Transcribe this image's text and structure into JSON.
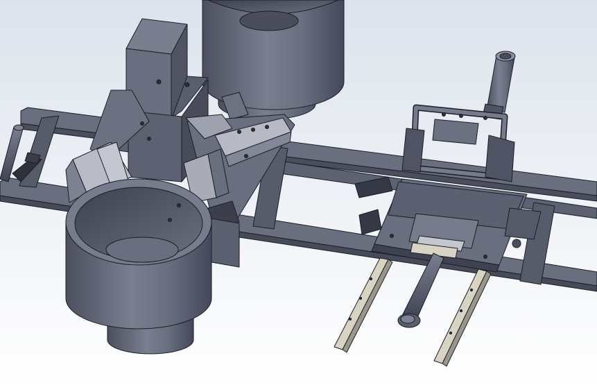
{
  "viewport": {
    "view": "isometric-3d",
    "display_mode": "shaded-with-edges",
    "background": {
      "top": "#dde3ec",
      "bottom": "#ffffff"
    }
  },
  "model": {
    "material_color": "#5f6475",
    "edge_color": "#1c1e26",
    "highlight_color": "#c9ccd6",
    "rail_highlight": "#d8d3c2",
    "components": [
      {
        "name": "main-frame-rails",
        "kind": "extrusion-frame"
      },
      {
        "name": "vibratory-bowl-front",
        "kind": "bowl"
      },
      {
        "name": "vibratory-bowl-rear",
        "kind": "bowl"
      },
      {
        "name": "hopper-tower",
        "kind": "square-column"
      },
      {
        "name": "feeder-bracket-plate",
        "kind": "plate"
      },
      {
        "name": "gripper-carriage",
        "kind": "carriage"
      },
      {
        "name": "pneumatic-cylinder-vertical",
        "kind": "cylinder"
      },
      {
        "name": "pneumatic-cylinder-horizontal",
        "kind": "cylinder"
      },
      {
        "name": "linear-guide-left",
        "kind": "linear-rail"
      },
      {
        "name": "linear-guide-right",
        "kind": "linear-rail"
      }
    ]
  }
}
